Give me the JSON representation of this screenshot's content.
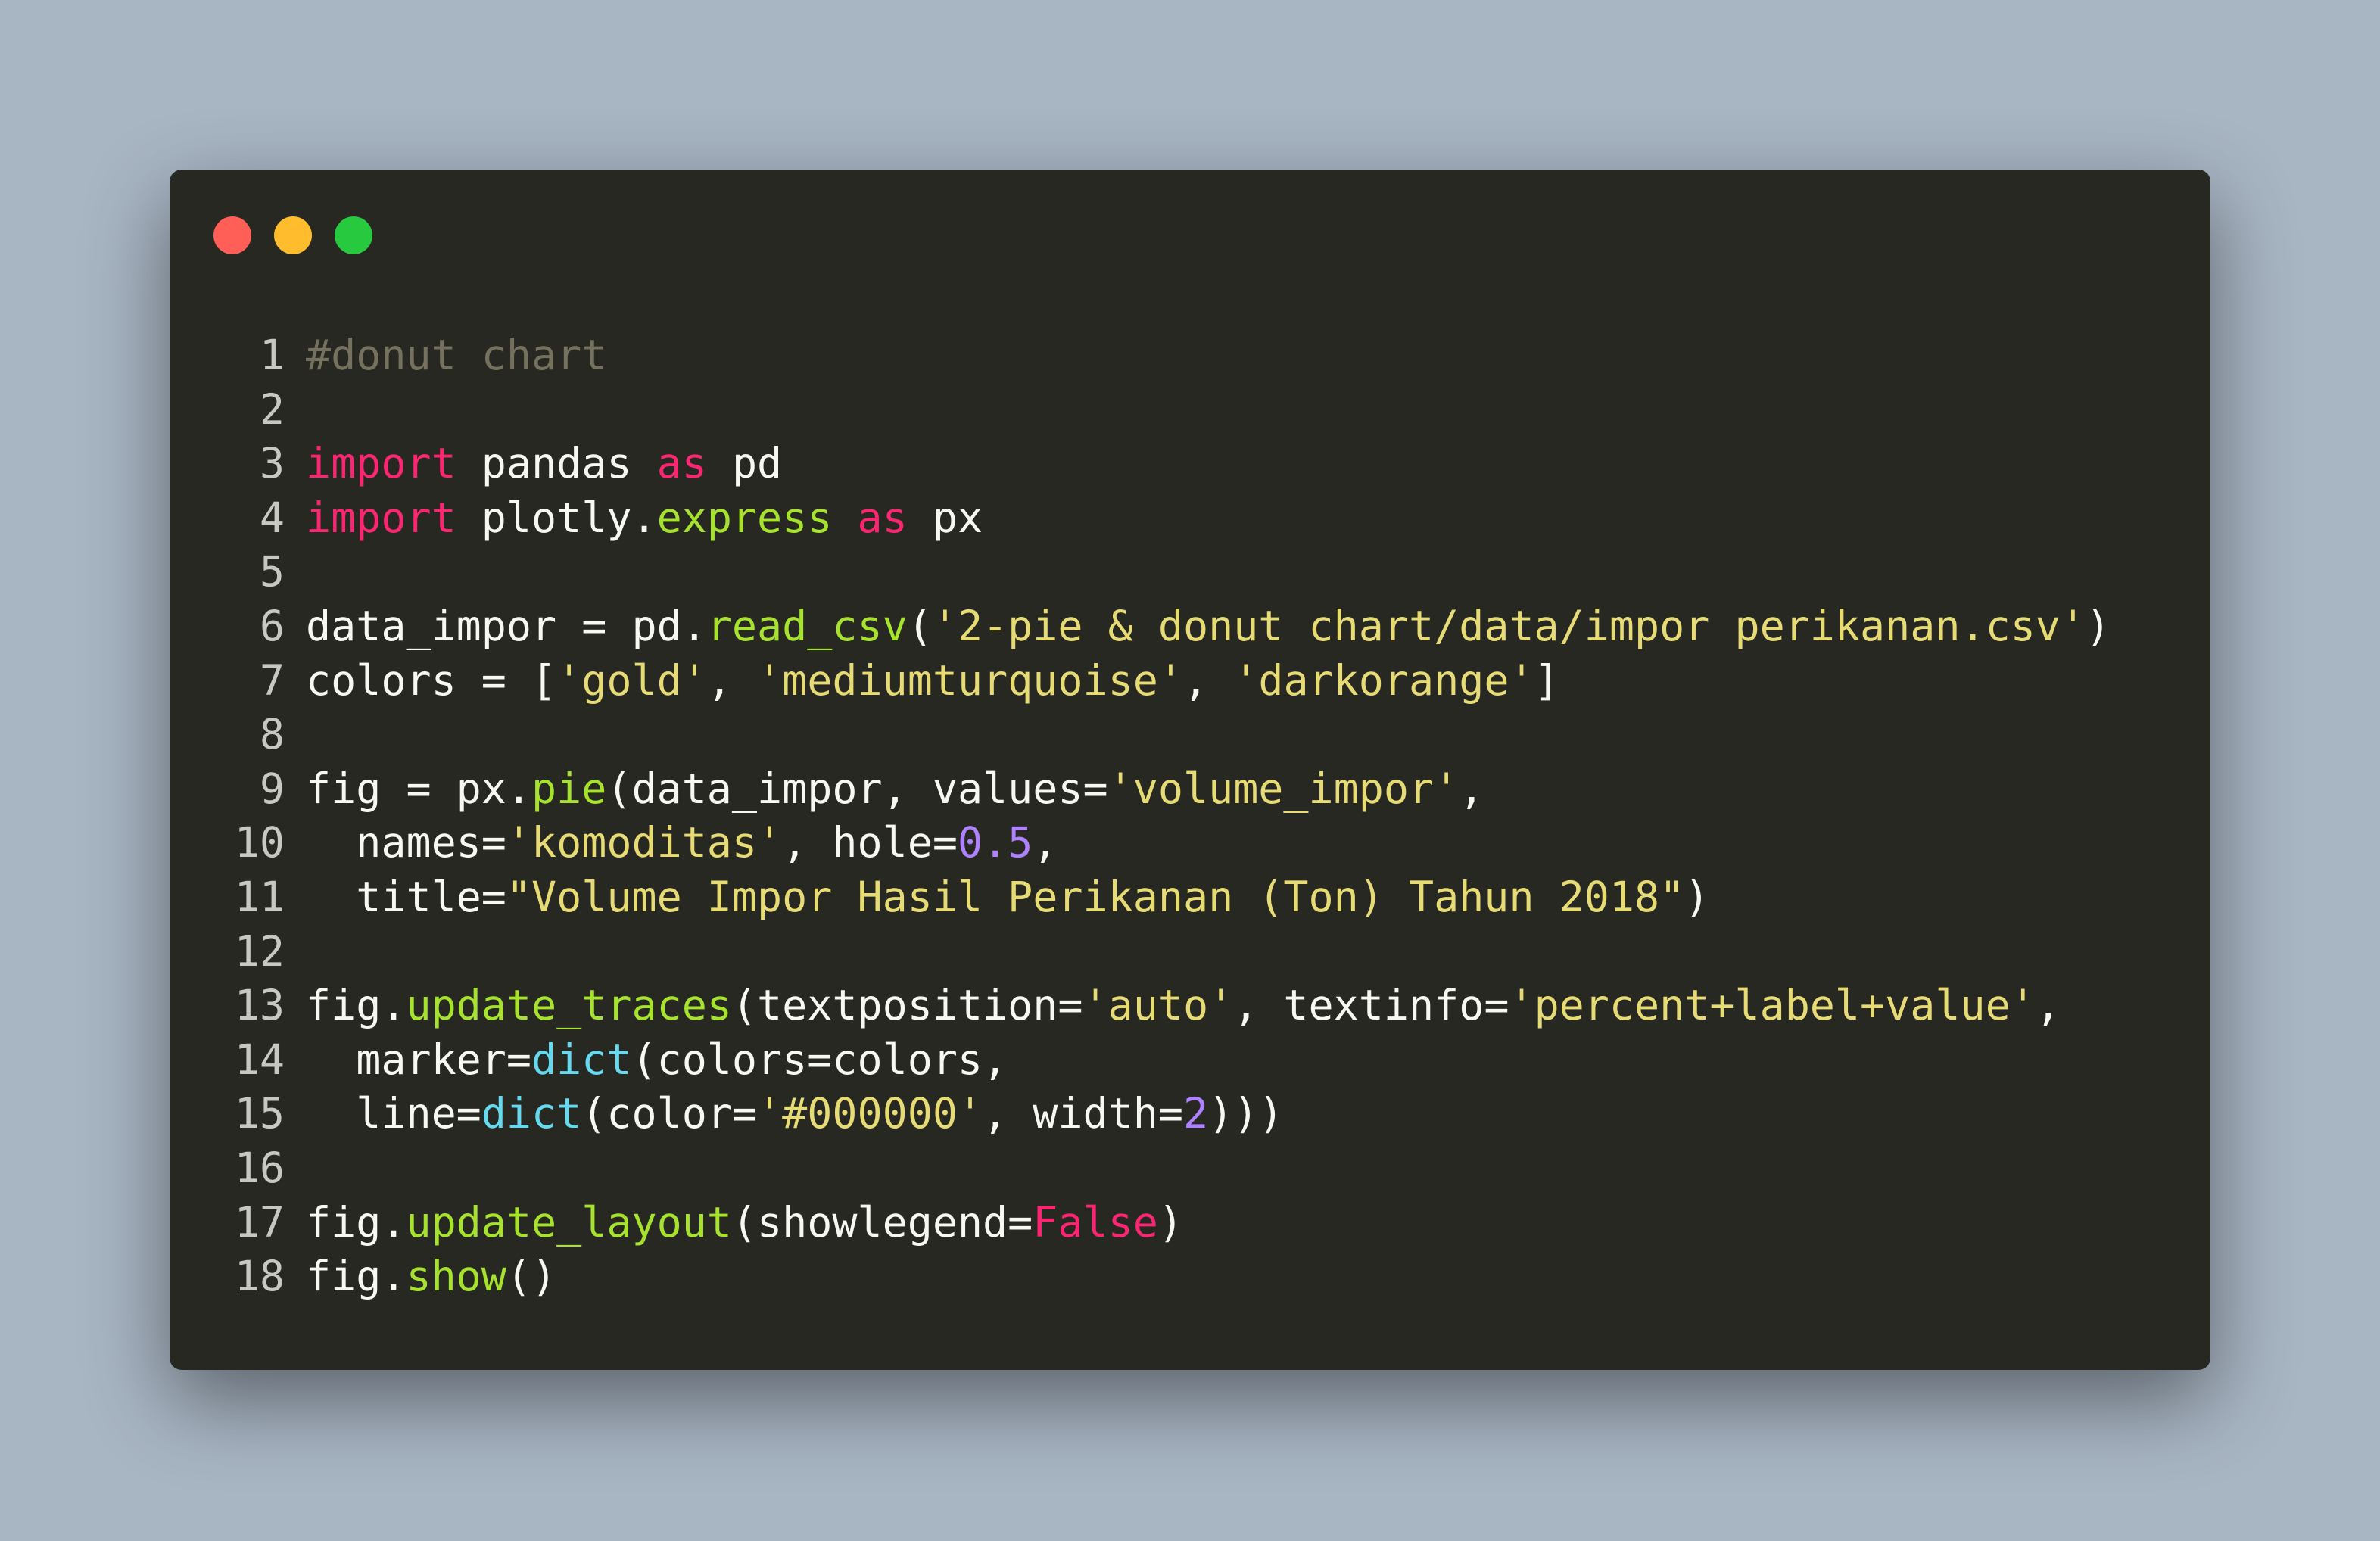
{
  "window": {
    "controls": [
      {
        "name": "close",
        "color": "#ff5f56"
      },
      {
        "name": "minimize",
        "color": "#ffbd2e"
      },
      {
        "name": "zoom",
        "color": "#27c93f"
      }
    ]
  },
  "theme": {
    "background": "#272822",
    "page_background": "#a8b5c3",
    "keyword": "#f92672",
    "function": "#a6e22e",
    "string": "#e6db74",
    "number": "#ae81ff",
    "builtin": "#66d9ef",
    "comment": "#75715e",
    "text": "#f8f8f2"
  },
  "code": {
    "lines": [
      {
        "n": "1",
        "tokens": [
          [
            "cm",
            "#donut chart"
          ]
        ]
      },
      {
        "n": "2",
        "tokens": []
      },
      {
        "n": "3",
        "tokens": [
          [
            "kw",
            "import"
          ],
          [
            "tx",
            " pandas "
          ],
          [
            "kw",
            "as"
          ],
          [
            "tx",
            " pd"
          ]
        ]
      },
      {
        "n": "4",
        "tokens": [
          [
            "kw",
            "import"
          ],
          [
            "tx",
            " plotly."
          ],
          [
            "fn",
            "express"
          ],
          [
            "tx",
            " "
          ],
          [
            "kw",
            "as"
          ],
          [
            "tx",
            " px"
          ]
        ]
      },
      {
        "n": "5",
        "tokens": []
      },
      {
        "n": "6",
        "tokens": [
          [
            "tx",
            "data_impor = pd."
          ],
          [
            "fn",
            "read_csv"
          ],
          [
            "tx",
            "("
          ],
          [
            "str",
            "'2-pie & donut chart/data/impor perikanan.csv'"
          ],
          [
            "tx",
            ")"
          ]
        ]
      },
      {
        "n": "7",
        "tokens": [
          [
            "tx",
            "colors = ["
          ],
          [
            "str",
            "'gold'"
          ],
          [
            "tx",
            ", "
          ],
          [
            "str",
            "'mediumturquoise'"
          ],
          [
            "tx",
            ", "
          ],
          [
            "str",
            "'darkorange'"
          ],
          [
            "tx",
            "]"
          ]
        ]
      },
      {
        "n": "8",
        "tokens": []
      },
      {
        "n": "9",
        "tokens": [
          [
            "tx",
            "fig = px."
          ],
          [
            "fn",
            "pie"
          ],
          [
            "tx",
            "(data_impor, values="
          ],
          [
            "str",
            "'volume_impor'"
          ],
          [
            "tx",
            ","
          ]
        ]
      },
      {
        "n": "10",
        "tokens": [
          [
            "tx",
            "  names="
          ],
          [
            "str",
            "'komoditas'"
          ],
          [
            "tx",
            ", hole="
          ],
          [
            "num",
            "0.5"
          ],
          [
            "tx",
            ","
          ]
        ]
      },
      {
        "n": "11",
        "tokens": [
          [
            "tx",
            "  title="
          ],
          [
            "str",
            "\"Volume Impor Hasil Perikanan (Ton) Tahun 2018\""
          ],
          [
            "tx",
            ")"
          ]
        ]
      },
      {
        "n": "12",
        "tokens": []
      },
      {
        "n": "13",
        "tokens": [
          [
            "tx",
            "fig."
          ],
          [
            "fn",
            "update_traces"
          ],
          [
            "tx",
            "(textposition="
          ],
          [
            "str",
            "'auto'"
          ],
          [
            "tx",
            ", textinfo="
          ],
          [
            "str",
            "'percent+label+value'"
          ],
          [
            "tx",
            ","
          ]
        ]
      },
      {
        "n": "14",
        "tokens": [
          [
            "tx",
            "  marker="
          ],
          [
            "bi",
            "dict"
          ],
          [
            "tx",
            "(colors=colors,"
          ]
        ]
      },
      {
        "n": "15",
        "tokens": [
          [
            "tx",
            "  line="
          ],
          [
            "bi",
            "dict"
          ],
          [
            "tx",
            "(color="
          ],
          [
            "str",
            "'#000000'"
          ],
          [
            "tx",
            ", width="
          ],
          [
            "num",
            "2"
          ],
          [
            "tx",
            ")))"
          ]
        ]
      },
      {
        "n": "16",
        "tokens": []
      },
      {
        "n": "17",
        "tokens": [
          [
            "tx",
            "fig."
          ],
          [
            "fn",
            "update_layout"
          ],
          [
            "tx",
            "(showlegend="
          ],
          [
            "kw",
            "False"
          ],
          [
            "tx",
            ")"
          ]
        ]
      },
      {
        "n": "18",
        "tokens": [
          [
            "tx",
            "fig."
          ],
          [
            "fn",
            "show"
          ],
          [
            "tx",
            "()"
          ]
        ]
      }
    ]
  }
}
